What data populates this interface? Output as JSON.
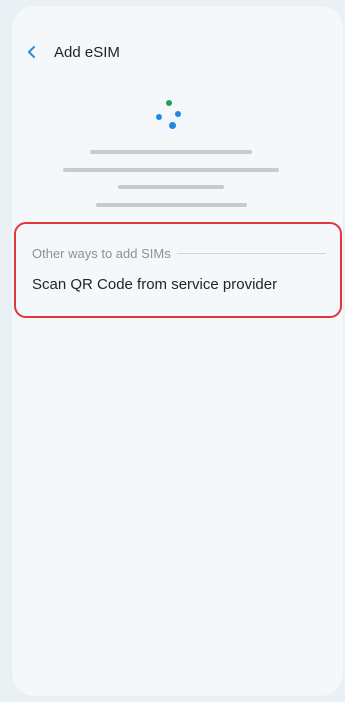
{
  "header": {
    "back_icon": "chevron-left-icon",
    "title": "Add eSIM"
  },
  "loader": {
    "icon": "loading-dots-icon",
    "colors": [
      "#1aa354",
      "#1e88e5",
      "#1e88e5",
      "#1e88e5"
    ]
  },
  "other_ways": {
    "section_label": "Other ways to add SIMs",
    "scan_qr_label": "Scan QR Code from service provider",
    "highlight_color": "#e0363c"
  },
  "colors": {
    "accent": "#2a8bd8",
    "background": "#f5f8fa"
  }
}
